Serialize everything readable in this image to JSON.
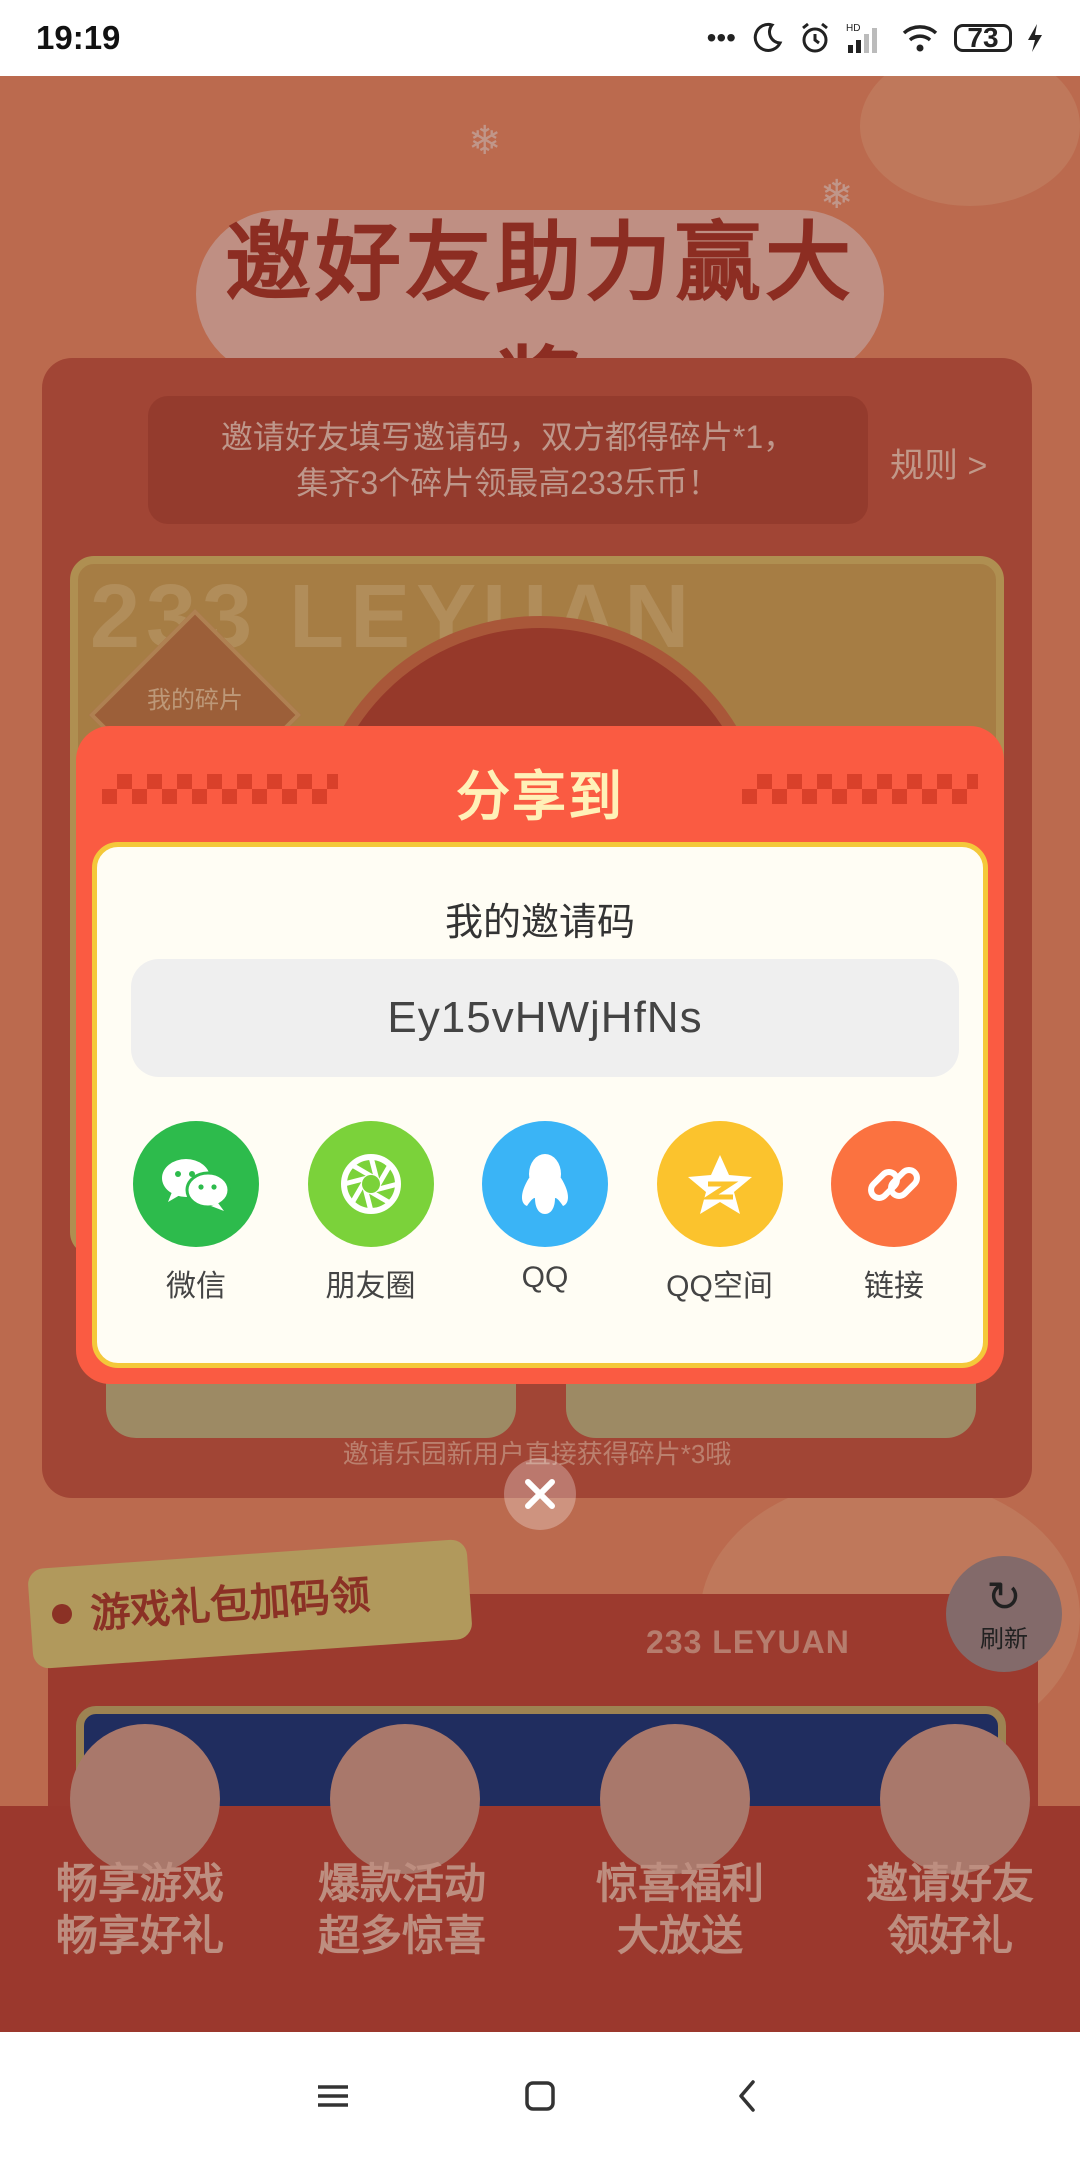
{
  "status_bar": {
    "time": "19:19",
    "hd_label": "HD",
    "battery": "73"
  },
  "page": {
    "banner_title": "邀好友助力赢大奖",
    "intro_line1": "邀请好友填写邀请码，双方都得碎片*1，",
    "intro_line2": "集齐3个碎片领最高233乐币！",
    "rules_link": "规则 >",
    "watermark": "233 LEYUAN",
    "my_piece": "我的碎片",
    "bottom_tip": "邀请乐园新用户直接获得碎片*3哦",
    "gift_section_title": "游戏礼包加码领",
    "leyuan_label": "233 LEYUAN",
    "features": [
      {
        "line1": "畅享游戏",
        "line2": "畅享好礼"
      },
      {
        "line1": "爆款活动",
        "line2": "超多惊喜"
      },
      {
        "line1": "惊喜福利",
        "line2": "大放送"
      },
      {
        "line1": "邀请好友",
        "line2": "领好礼"
      }
    ]
  },
  "refresh_button": {
    "label": "刷新"
  },
  "dialog": {
    "title": "分享到",
    "code_label": "我的邀请码",
    "code_value": "Ey15vHWjHfNs",
    "share_targets": [
      {
        "label": "微信",
        "icon": "wechat-icon",
        "color": "#2dbb4c"
      },
      {
        "label": "朋友圈",
        "icon": "moments-icon",
        "color": "#7bd23a"
      },
      {
        "label": "QQ",
        "icon": "qq-icon",
        "color": "#3ab4f6"
      },
      {
        "label": "QQ空间",
        "icon": "qzone-icon",
        "color": "#fbc32d"
      },
      {
        "label": "链接",
        "icon": "link-icon",
        "color": "#fb7240"
      }
    ]
  },
  "colors": {
    "dialog_red": "#fa5b42",
    "dialog_gold_border": "#f4c83a",
    "title_cream": "#fff1b8"
  }
}
